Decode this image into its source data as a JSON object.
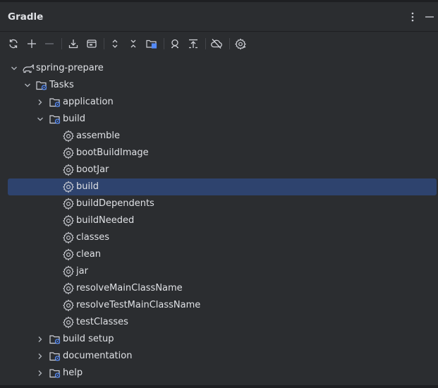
{
  "panel": {
    "title": "Gradle"
  },
  "header_icons": [
    "more-vertical-icon",
    "minimize-icon"
  ],
  "toolbar": {
    "buttons": [
      "reload-icon",
      "add-icon",
      "remove-icon",
      "download-sources-icon",
      "toggle-offline-icon",
      "expand-all-icon",
      "collapse-all-icon",
      "link-project-icon",
      "analyze-dependencies-icon",
      "show-dependencies-icon",
      "cloud-off-icon",
      "build-tool-settings-icon"
    ]
  },
  "tree": {
    "project": "spring-prepare",
    "tasks_folder": "Tasks",
    "groups": [
      "application",
      "build",
      "build setup",
      "documentation",
      "help"
    ],
    "build_tasks": [
      "assemble",
      "bootBuildImage",
      "bootJar",
      "build",
      "buildDependents",
      "buildNeeded",
      "classes",
      "clean",
      "jar",
      "resolveMainClassName",
      "resolveTestMainClassName",
      "testClasses"
    ],
    "selected_task": "build"
  },
  "colors": {
    "background": "#2b2d30",
    "selection": "#2e436e",
    "text": "#dfe1e5",
    "accent_blue": "#548af7"
  }
}
